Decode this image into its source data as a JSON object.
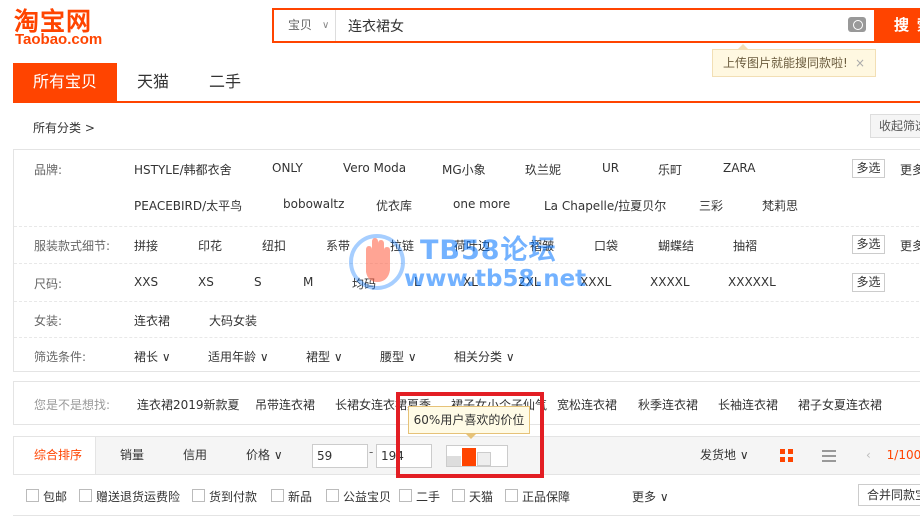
{
  "logo": {
    "chinese": "淘宝网",
    "english": "Taobao.com"
  },
  "search": {
    "type": "宝贝",
    "query": "连衣裙女",
    "button": "搜索",
    "image_tip": "上传图片就能搜同款啦!",
    "tip_close": "×"
  },
  "tabs": [
    {
      "label": "所有宝贝",
      "active": true
    },
    {
      "label": "天猫"
    },
    {
      "label": "二手"
    }
  ],
  "breadcrumb": "所有分类 >",
  "collapse_button": "收起筛选",
  "filters": {
    "brand": {
      "label": "品牌:",
      "row1": [
        "HSTYLE/韩都衣舍",
        "ONLY",
        "Vero Moda",
        "MG小象",
        "玖兰妮",
        "UR",
        "乐町",
        "ZARA"
      ],
      "row2": [
        "PEACEBIRD/太平鸟",
        "bobowaltz",
        "优衣库",
        "one more",
        "La Chapelle/拉夏贝尔",
        "三彩",
        "梵莉思"
      ]
    },
    "style": {
      "label": "服装款式细节:",
      "values": [
        "拼接",
        "印花",
        "纽扣",
        "系带",
        "拉链",
        "荷叶边",
        "褶皱",
        "口袋",
        "蝴蝶结",
        "抽褶"
      ]
    },
    "size": {
      "label": "尺码:",
      "values": [
        "XXS",
        "XS",
        "S",
        "M",
        "均码",
        "L",
        "XL",
        "2XL",
        "XXXL",
        "XXXXL",
        "XXXXXL"
      ]
    },
    "women": {
      "label": "女装:",
      "values": [
        "连衣裙",
        "大码女装"
      ]
    },
    "conditions": {
      "label": "筛选条件:",
      "values": [
        "裙长",
        "适用年龄",
        "裙型",
        "腰型",
        "相关分类"
      ]
    },
    "multi_label": "多选",
    "more_label": "更多"
  },
  "related": {
    "label": "您是不是想找:",
    "links": [
      "连衣裙2019新款夏",
      "吊带连衣裙",
      "长裙女连衣裙夏季",
      "裙子女小个子仙气",
      "宽松连衣裙",
      "秋季连衣裙",
      "长袖连衣裙",
      "裙子女夏连衣裙"
    ]
  },
  "sort": {
    "items": [
      "综合排序",
      "销量",
      "信用",
      "价格"
    ],
    "price_min": "59",
    "price_max": "194",
    "price_dash": "-",
    "price_tip": "60%用户喜欢的价位",
    "ship_from": "发货地",
    "page": "1/100"
  },
  "checks": [
    "包邮",
    "赠送退货运费险",
    "货到付款",
    "新品",
    "公益宝贝",
    "二手",
    "天猫",
    "正品保障"
  ],
  "more_filters": "更多",
  "merge": "合并同款宝贝",
  "watermark": {
    "line1": "TB58论坛",
    "line2": "www.tb58.net"
  },
  "colors": {
    "accent": "#ff4400",
    "highlight_box": "#e31e24",
    "watermark": "#0072ff"
  }
}
